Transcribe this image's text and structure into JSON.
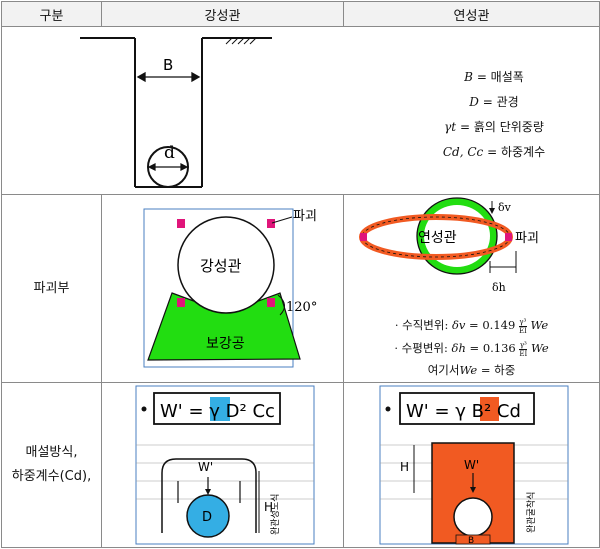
{
  "headers": {
    "col1": "구분",
    "col2": "강성관",
    "col3": "연성관"
  },
  "row1": {
    "trench_label_B": "B",
    "pipe_label_d": "d",
    "legend": [
      {
        "sym": "B",
        "text": " = 매설폭"
      },
      {
        "sym": "D",
        "text": " = 관경"
      },
      {
        "sym": "γt",
        "text": " = 흙의 단위중량"
      },
      {
        "sym": "Cd, Cc",
        "text": " = 하중계수"
      }
    ]
  },
  "row2": {
    "label": "파괴부",
    "rigid": {
      "pipe_label": "강성관",
      "fail_label": "파괴",
      "angle_label": "120°",
      "bedding_label": "보강공"
    },
    "flex": {
      "pipe_label": "연성관",
      "fail_label": "파괴",
      "dv_label": "δv",
      "dh_label": "δh",
      "vertical": {
        "prefix": "· 수직변위: ",
        "sym": "δv",
        "eq": " = 0.149",
        "num": "γ³",
        "den": "EI",
        "tail": "We"
      },
      "horizontal": {
        "prefix": "· 수평변위: ",
        "sym": "δh",
        "eq": " = 0.136",
        "num": "γ³",
        "den": "EI",
        "tail": "We"
      },
      "note": {
        "pre": "여기서",
        "sym": "We",
        "post": " = 하중"
      }
    }
  },
  "row3": {
    "label_line1": "매설방식,",
    "label_line2": "하중계수(Cd),",
    "rigid": {
      "formula": "W' = γ D² Cc",
      "load": "W'",
      "H": "H",
      "D": "D",
      "side": "완관성도식"
    },
    "flex": {
      "formula": "W' = γ B² Cd",
      "load": "W'",
      "H": "H",
      "B": "B",
      "side": "완관굴착식"
    }
  },
  "colors": {
    "orange": "#f15a22",
    "green": "#22dd11",
    "cyan": "#34aee4",
    "magenta": "#e0157a",
    "box_border": "#4a7fc0"
  }
}
